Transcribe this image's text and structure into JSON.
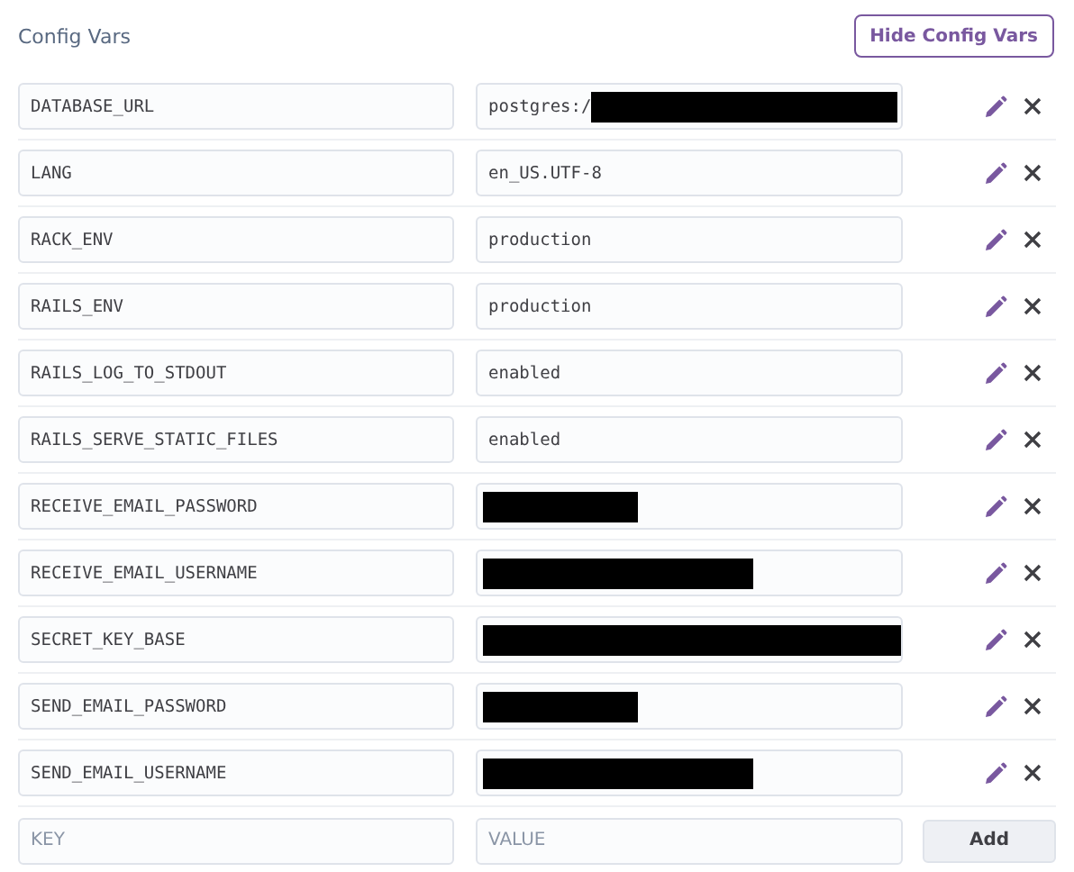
{
  "title": "Config Vars",
  "hide_button": "Hide Config Vars",
  "vars": [
    {
      "key": "DATABASE_URL",
      "value": "postgres:/",
      "kind": "masklong"
    },
    {
      "key": "LANG",
      "value": "en_US.UTF-8",
      "kind": "plain"
    },
    {
      "key": "RACK_ENV",
      "value": "production",
      "kind": "plain"
    },
    {
      "key": "RAILS_ENV",
      "value": "production",
      "kind": "plain"
    },
    {
      "key": "RAILS_LOG_TO_STDOUT",
      "value": "enabled",
      "kind": "plain"
    },
    {
      "key": "RAILS_SERVE_STATIC_FILES",
      "value": "enabled",
      "kind": "plain"
    },
    {
      "key": "RECEIVE_EMAIL_PASSWORD",
      "kind": "maskshort"
    },
    {
      "key": "RECEIVE_EMAIL_USERNAME",
      "kind": "maskmedium"
    },
    {
      "key": "SECRET_KEY_BASE",
      "kind": "maskfull"
    },
    {
      "key": "SEND_EMAIL_PASSWORD",
      "kind": "maskshort"
    },
    {
      "key": "SEND_EMAIL_USERNAME",
      "kind": "maskmedium"
    }
  ],
  "new_var": {
    "key_placeholder": "KEY",
    "value_placeholder": "VALUE",
    "add_button": "Add"
  }
}
